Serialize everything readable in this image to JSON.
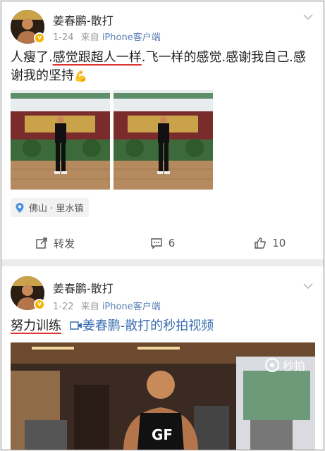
{
  "posts": [
    {
      "username": "姜春鹏-散打",
      "date": "1-24",
      "source_prefix": "来自",
      "source": "iPhone客户端",
      "text_part1": "人瘦了.",
      "text_underlined": "感觉跟超人一样",
      "text_part2": ".飞一样的感觉.感谢我自己.感谢我的坚持",
      "emoji": "💪",
      "location": "佛山 · 里水镇",
      "actions": {
        "repost": "转发",
        "comments": "6",
        "likes": "10"
      }
    },
    {
      "username": "姜春鹏-散打",
      "date": "1-22",
      "source_prefix": "来自",
      "source": "iPhone客户端",
      "tag": "努力训练",
      "link_text": "姜春鹏-散打的秒拍视频",
      "watermark": "秒拍"
    }
  ],
  "colors": {
    "link": "#3a6fb0",
    "underline": "#d33333",
    "verify": "#f5b400"
  }
}
